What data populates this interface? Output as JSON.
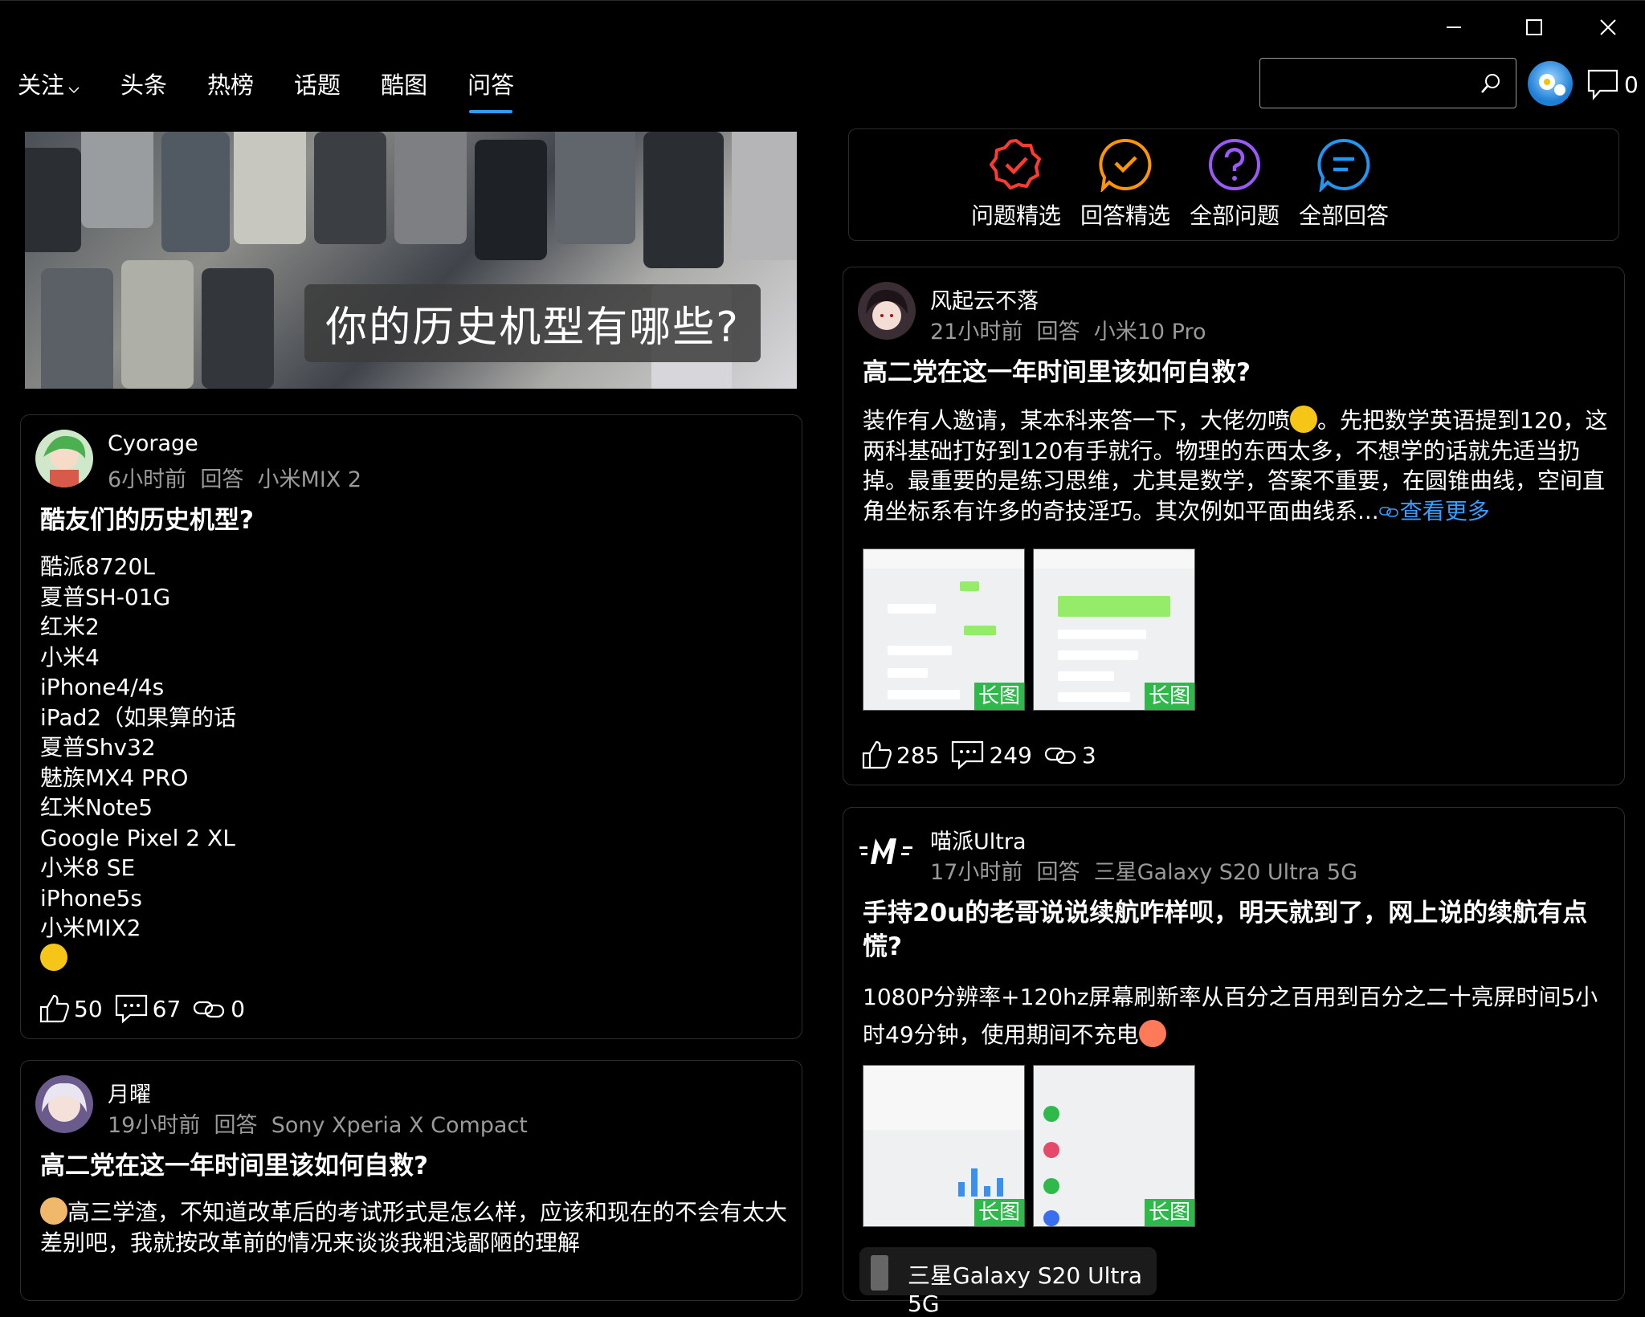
{
  "window": {
    "minimize": "—",
    "maximize": "☐",
    "close": "✕"
  },
  "nav": {
    "tabs": [
      {
        "label": "关注"
      },
      {
        "label": "头条"
      },
      {
        "label": "热榜"
      },
      {
        "label": "话题"
      },
      {
        "label": "酷图"
      },
      {
        "label": "问答"
      }
    ],
    "active": "问答",
    "message_count": "0"
  },
  "search": {
    "placeholder": "",
    "value": ""
  },
  "banner": {
    "caption": "你的历史机型有哪些?"
  },
  "categories": [
    {
      "label": "问题精选",
      "color": "#ff3b30"
    },
    {
      "label": "回答精选",
      "color": "#ff9500"
    },
    {
      "label": "全部问题",
      "color": "#9b59f5"
    },
    {
      "label": "全部回答",
      "color": "#2196f3"
    }
  ],
  "left_cards": [
    {
      "user": "Cyorage",
      "time": "6小时前",
      "action": "回答",
      "device": "小米MIX 2",
      "title": "酷友们的历史机型?",
      "lines": [
        "酷派8720L",
        "夏普SH-01G",
        "红米2",
        "小米4",
        "iPhone4/4s",
        "iPad2（如果算的话",
        "夏普Shv32",
        "魅族MX4 PRO",
        "红米Note5",
        "Google Pixel 2 XL",
        "小米8 SE",
        "iPhone5s",
        "小米MIX2"
      ],
      "likes": "50",
      "comments": "67",
      "shares": "0"
    },
    {
      "user": "月曜",
      "time": "19小时前",
      "action": "回答",
      "device": "Sony Xperia X Compact",
      "title": "高二党在这一年时间里该如何自救?",
      "body": "高三学渣，不知道改革后的考试形式是怎么样，应该和现在的不会有太大差别吧，我就按改革前的情况来谈谈我粗浅鄙陋的理解"
    }
  ],
  "right_cards": [
    {
      "user": "风起云不落",
      "time": "21小时前",
      "action": "回答",
      "device": "小米10 Pro",
      "title": "高二党在这一年时间里该如何自救?",
      "body_a": "装作有人邀请，某本科来答一下，大佬勿喷",
      "body_b": "。先把数学英语提到120，这两科基础打好到120有手就行。物理的东西太多，不想学的话就先适当扔掉。最重要的是练习思维，尤其是数学，答案不重要，在圆锥曲线，空间直角坐标系有许多的奇技淫巧。其次例如平面曲线系...",
      "more": "查看更多",
      "long_tag": "长图",
      "likes": "285",
      "comments": "249",
      "shares": "3"
    },
    {
      "user": "喵派Ultra",
      "time": "17小时前",
      "action": "回答",
      "device": "三星Galaxy S20 Ultra 5G",
      "title": "手持20u的老哥说说续航咋样呗，明天就到了，网上说的续航有点慌?",
      "body": "1080P分辨率+120hz屏幕刷新率从百分之百用到百分之二十亮屏时间5小时49分钟，使用期间不充电",
      "long_tag": "长图",
      "chip": "三星Galaxy S20 Ultra 5G"
    }
  ]
}
